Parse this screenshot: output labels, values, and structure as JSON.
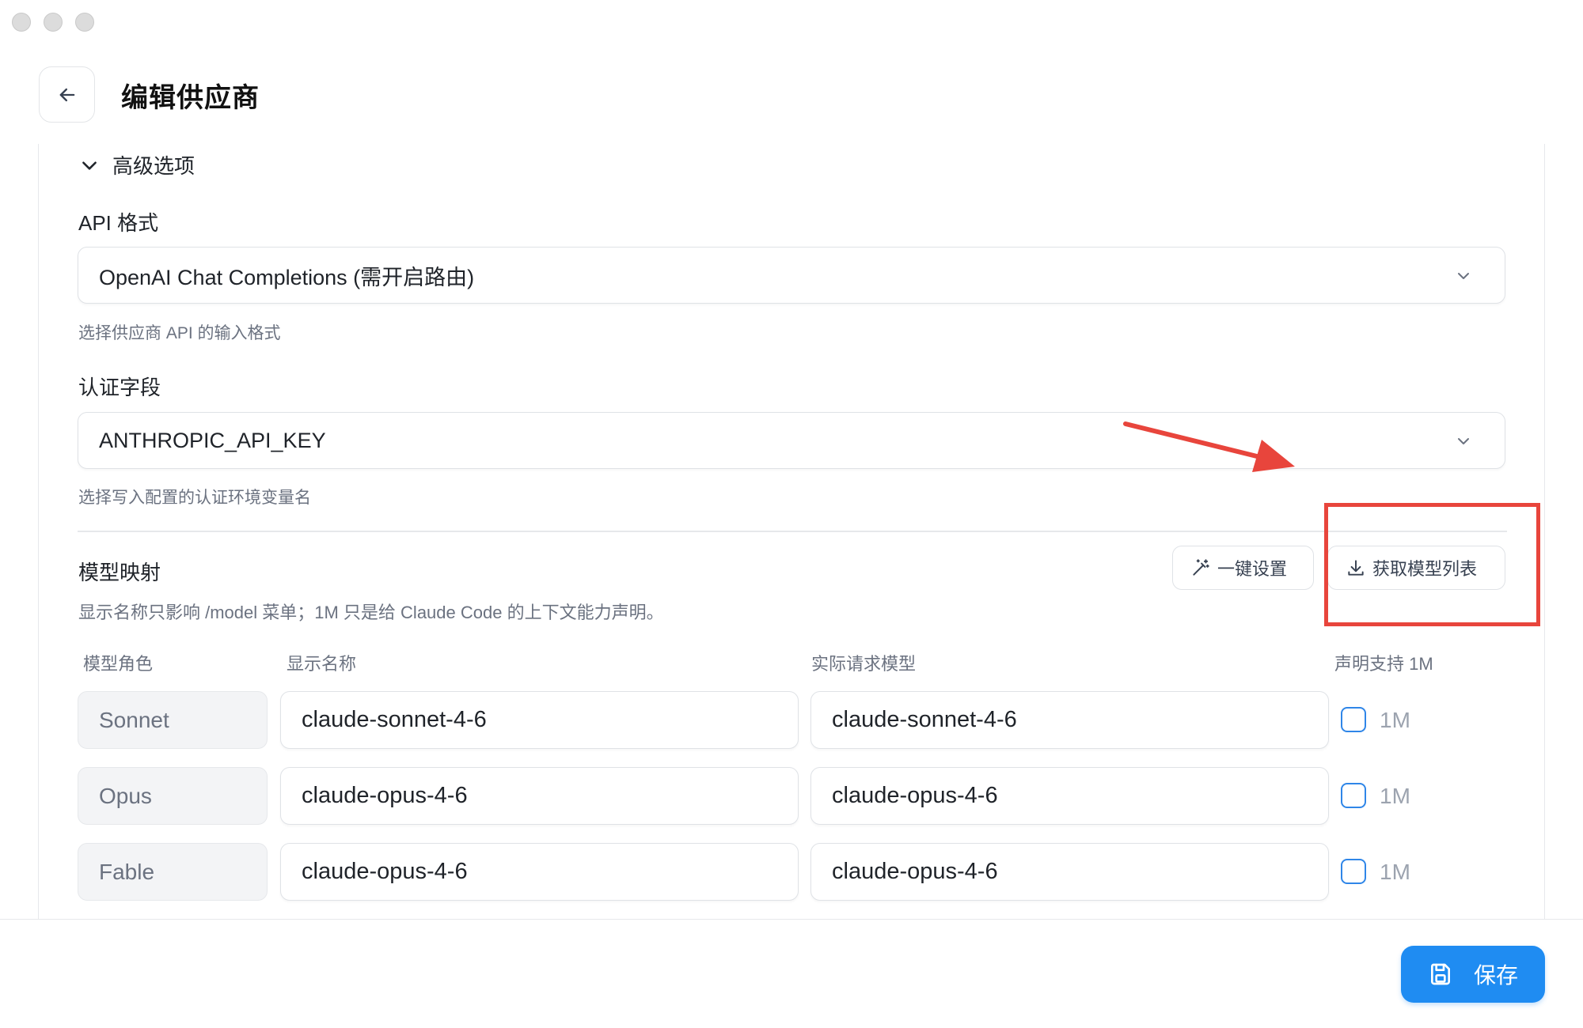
{
  "header": {
    "title": "编辑供应商",
    "back_icon": "arrow-left-icon"
  },
  "advanced": {
    "section_title": "高级选项",
    "api_format": {
      "label": "API 格式",
      "value": "OpenAI Chat Completions (需开启路由)",
      "hint": "选择供应商 API 的输入格式"
    },
    "auth_field": {
      "label": "认证字段",
      "value": "ANTHROPIC_API_KEY",
      "hint": "选择写入配置的认证环境变量名"
    }
  },
  "model_mapping": {
    "title": "模型映射",
    "description": "显示名称只影响 /model 菜单；1M 只是给 Claude Code 的上下文能力声明。",
    "quick_setup_label": "一键设置",
    "fetch_models_label": "获取模型列表",
    "columns": [
      "模型角色",
      "显示名称",
      "实际请求模型",
      "声明支持 1M"
    ],
    "rows": [
      {
        "role": "Sonnet",
        "display_name": "claude-sonnet-4-6",
        "request_model": "claude-sonnet-4-6",
        "support_1m_label": "1M",
        "support_1m": false
      },
      {
        "role": "Opus",
        "display_name": "claude-opus-4-6",
        "request_model": "claude-opus-4-6",
        "support_1m_label": "1M",
        "support_1m": false
      },
      {
        "role": "Fable",
        "display_name": "claude-opus-4-6",
        "request_model": "claude-opus-4-6",
        "support_1m_label": "1M",
        "support_1m": false
      }
    ]
  },
  "footer": {
    "save_label": "保存"
  },
  "colors": {
    "accent": "#1f8cf2",
    "annotation": "#e8453c",
    "checkbox_border": "#2f86e8"
  }
}
